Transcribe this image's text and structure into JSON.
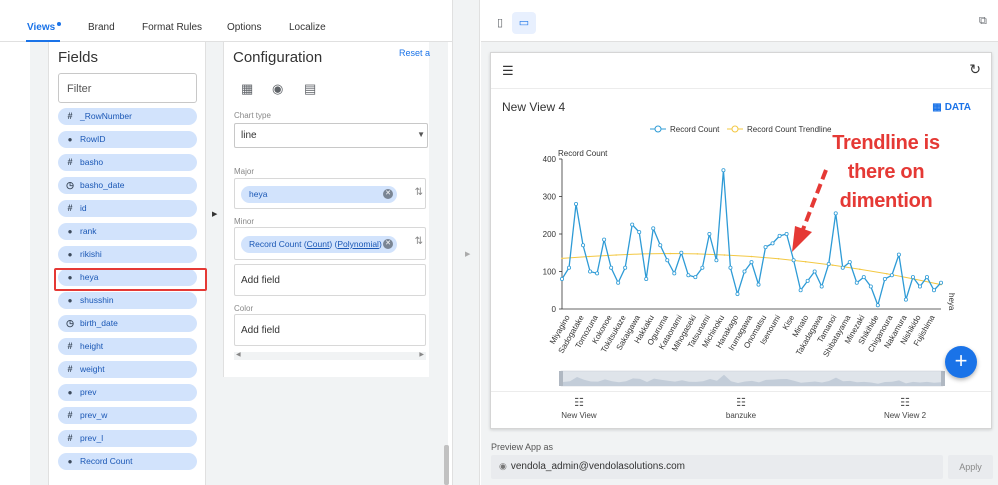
{
  "topnav": {
    "tabs": [
      {
        "label": "Views",
        "active": true
      },
      {
        "label": "Brand",
        "active": false
      },
      {
        "label": "Format Rules",
        "active": false
      },
      {
        "label": "Options",
        "active": false
      },
      {
        "label": "Localize",
        "active": false
      }
    ]
  },
  "fields_panel": {
    "title": "Fields",
    "filter_placeholder": "Filter",
    "fields": [
      {
        "label": "_RowNumber",
        "icon": "hash-icon"
      },
      {
        "label": "RowID",
        "icon": "dot-icon"
      },
      {
        "label": "basho",
        "icon": "hash-icon"
      },
      {
        "label": "basho_date",
        "icon": "clock-icon"
      },
      {
        "label": "id",
        "icon": "hash-icon"
      },
      {
        "label": "rank",
        "icon": "dot-icon"
      },
      {
        "label": "rikishi",
        "icon": "dot-icon"
      },
      {
        "label": "heya",
        "icon": "dot-icon"
      },
      {
        "label": "shusshin",
        "icon": "dot-icon"
      },
      {
        "label": "birth_date",
        "icon": "clock-icon"
      },
      {
        "label": "height",
        "icon": "hash-icon"
      },
      {
        "label": "weight",
        "icon": "hash-icon"
      },
      {
        "label": "prev",
        "icon": "dot-icon"
      },
      {
        "label": "prev_w",
        "icon": "hash-icon"
      },
      {
        "label": "prev_l",
        "icon": "hash-icon"
      },
      {
        "label": "Record Count",
        "icon": "dot-icon"
      }
    ],
    "highlighted_field": "heya"
  },
  "config_panel": {
    "title": "Configuration",
    "reset_label": "Reset a",
    "chart_type_label": "Chart type",
    "chart_type_value": "line",
    "major_label": "Major",
    "major_chip": "heya",
    "minor_label": "Minor",
    "minor_chip": {
      "prefix": "Record Count ",
      "agg": "Count",
      "trend": "Polynomial"
    },
    "add_field_label": "Add field",
    "color_label": "Color",
    "color_add_field_label": "Add field"
  },
  "preview": {
    "view_title": "New View 4",
    "data_button": "DATA",
    "nav": [
      {
        "label": "New View",
        "icon": "list-icon"
      },
      {
        "label": "banzuke",
        "icon": "list-icon"
      },
      {
        "label": "New View 2",
        "icon": "list-icon"
      }
    ],
    "fab_label": "+",
    "preview_as_label": "Preview App as",
    "preview_as_value": "vendola_admin@vendolasolutions.com",
    "apply_label": "Apply"
  },
  "annotation": {
    "lines": [
      "Trendline is",
      "there on",
      "dimention"
    ],
    "color": "#e53935"
  },
  "colors": {
    "accent": "#1a73e8",
    "series": "#2e9bd6",
    "trend": "#f3c842",
    "highlight": "#e53935"
  },
  "chart_data": {
    "type": "line",
    "xlabel": "heya",
    "ylabel": "Record Count",
    "ylim": [
      0,
      400
    ],
    "yticks": [
      "0",
      "100",
      "200",
      "300",
      "400"
    ],
    "legend": [
      "Record Count",
      "Record Count Trendline"
    ],
    "legend_position": "top",
    "category_labels": [
      "Miyagino",
      "Sadogatake",
      "Tomozuna",
      "Kokonoe",
      "Tokitsukaze",
      "Sakaigawa",
      "Hakkaku",
      "Oguruma",
      "Kataonami",
      "Mihogaseki",
      "Tatsunami",
      "Michinoku",
      "Hanakago",
      "Irumagawa",
      "Onomatsu",
      "Isenoumi",
      "Kise",
      "Minato",
      "Takadagawa",
      "Tamanoi",
      "Shibatayama",
      "Minezaki",
      "Shikihide",
      "Chiganoura",
      "Nakamura",
      "Nishikido",
      "Fujishima"
    ],
    "series": [
      {
        "name": "Record Count",
        "values": [
          80,
          110,
          280,
          170,
          100,
          95,
          185,
          110,
          70,
          110,
          225,
          205,
          80,
          215,
          170,
          130,
          95,
          150,
          90,
          85,
          110,
          200,
          130,
          370,
          110,
          40,
          100,
          125,
          65,
          165,
          175,
          195,
          200,
          130,
          50,
          75,
          100,
          60,
          120,
          255,
          110,
          125,
          70,
          85,
          60,
          10,
          80,
          90,
          145,
          25,
          85,
          60,
          85,
          50,
          70
        ]
      },
      {
        "name": "Record Count Trendline",
        "values": [
          135,
          140,
          144,
          147,
          148,
          147,
          144,
          140,
          134,
          126,
          117,
          106,
          94,
          80,
          65
        ]
      }
    ]
  }
}
